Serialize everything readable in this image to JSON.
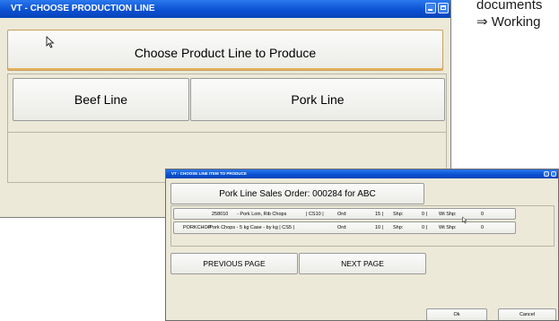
{
  "background": {
    "line1": "documents",
    "line2": "Working"
  },
  "window_main": {
    "title": "VT - CHOOSE PRODUCTION LINE",
    "header_button": "Choose Product Line to Produce",
    "lines": [
      {
        "label": "Beef Line"
      },
      {
        "label": "Pork Line"
      }
    ]
  },
  "window_order": {
    "title": "VT - CHOOSE LINE ITEM TO PRODUCE",
    "header_button": "Pork Line Sales Order: 000284 for ABC",
    "items": [
      {
        "code": "258010",
        "desc": "- Pork Loin, Rib Chops",
        "unit": "| CS10 |",
        "ord_label": "Ord:",
        "ord": "15 |",
        "shp_label": "Shp:",
        "shp": "0 |",
        "wt_label": "Wt Shp:",
        "wt": "0"
      },
      {
        "code": "PORKCHOP",
        "desc": "- Pork Chops - 5 kg Case - by kg | CS5 |",
        "unit": "",
        "ord_label": "Ord:",
        "ord": "10 |",
        "shp_label": "Shp:",
        "shp": "0 |",
        "wt_label": "Wt Shp:",
        "wt": "0"
      }
    ],
    "prev_page": "PREVIOUS PAGE",
    "next_page": "NEXT PAGE",
    "ok": "Ok",
    "cancel": "Cancel"
  },
  "colors": {
    "titlebar": "#0a4fd0",
    "window_bg": "#ece9d8",
    "header_highlight": "#e6b060"
  }
}
